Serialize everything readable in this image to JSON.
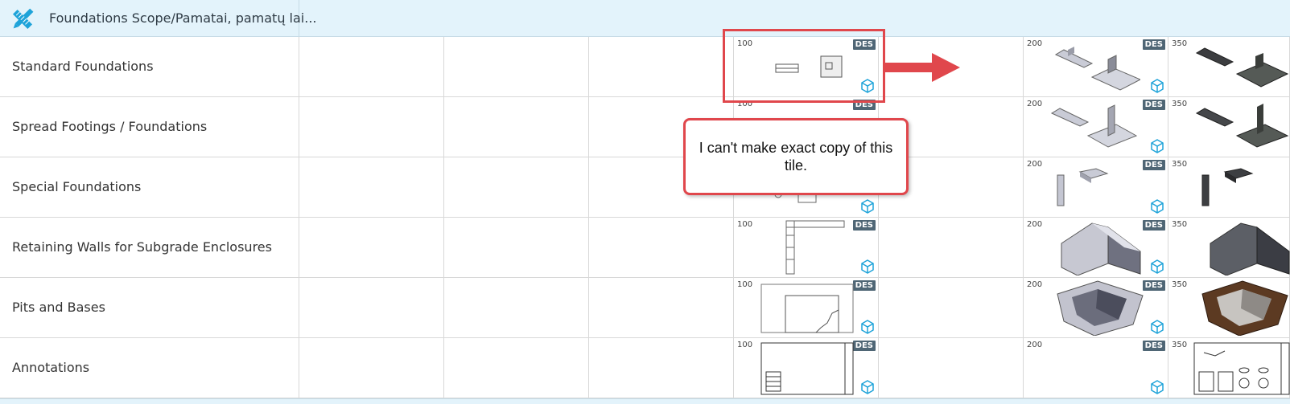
{
  "header": {
    "title": "Foundations Scope/Pamatai, pamatų lai..."
  },
  "rows": [
    {
      "label": "Standard Foundations"
    },
    {
      "label": "Spread Footings / Foundations"
    },
    {
      "label": "Special Foundations"
    },
    {
      "label": "Retaining Walls for Subgrade Enclosures"
    },
    {
      "label": "Pits and Bases"
    },
    {
      "label": "Annotations"
    }
  ],
  "tiles": {
    "col100": {
      "num": "100",
      "badge": "DES"
    },
    "col200": {
      "num": "200",
      "badge": "DES"
    },
    "col350": {
      "num": "350",
      "badge": "DES"
    }
  },
  "callout": {
    "text": "I can't make exact copy of this tile."
  },
  "colors": {
    "header_bg": "#e3f3fb",
    "accent_red": "#e0474c",
    "badge_bg": "#4f6675",
    "cube_blue": "#1ea3d9"
  },
  "icons": {
    "header": "pencil-ruler-icon",
    "tile": "cube-icon"
  }
}
